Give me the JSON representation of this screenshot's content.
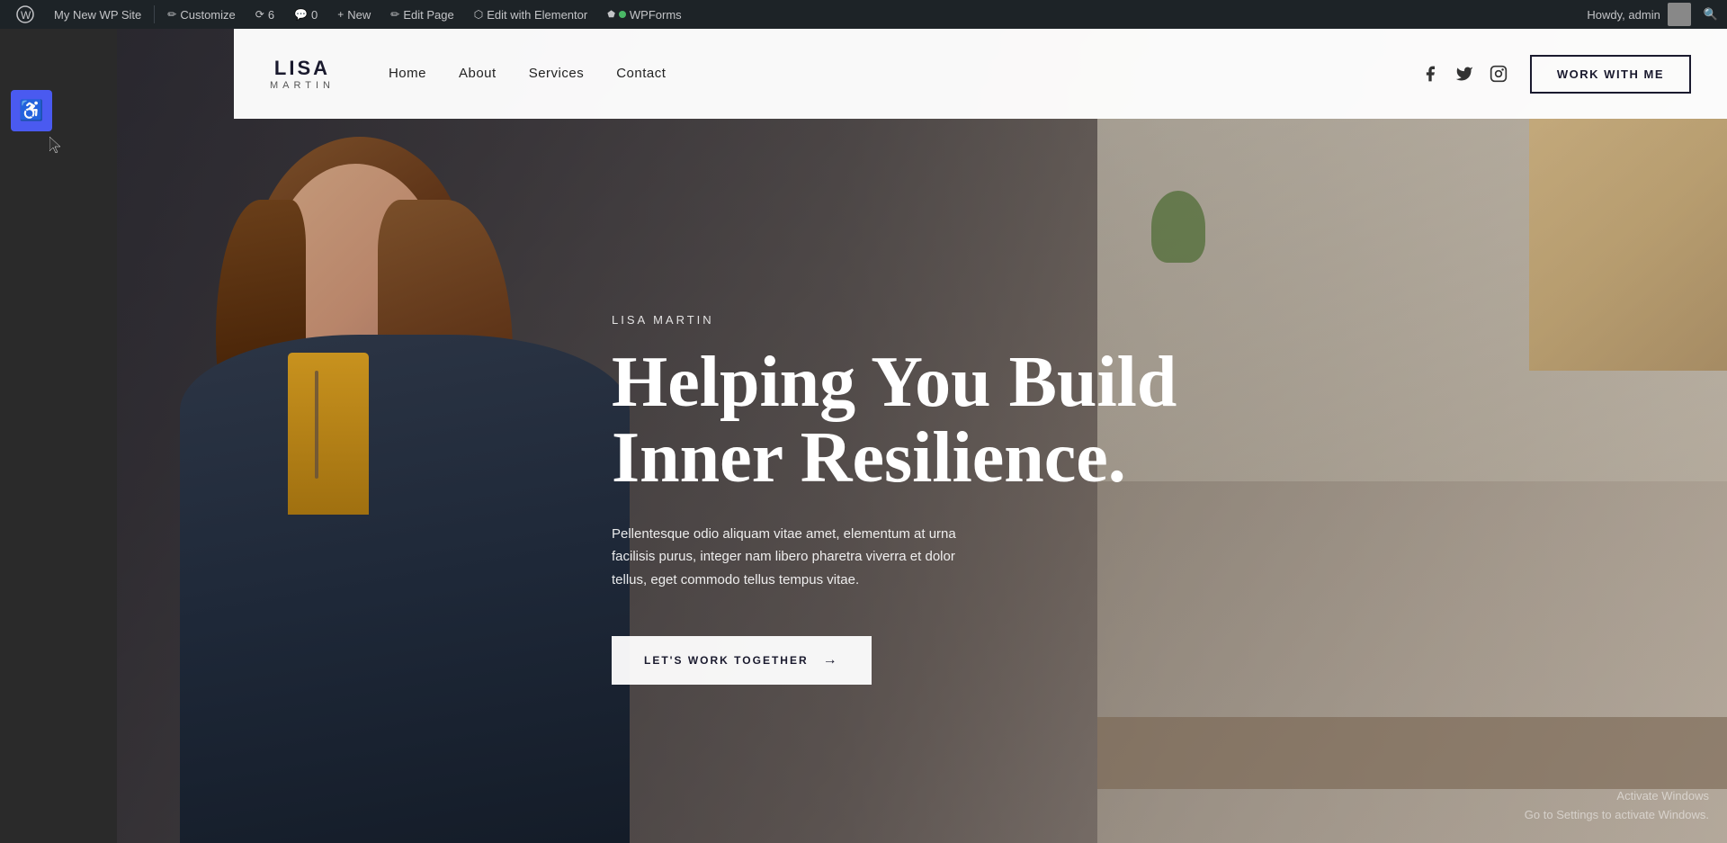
{
  "adminBar": {
    "siteTitle": "My New WP Site",
    "customize": "Customize",
    "comments": "0",
    "revisions": "6",
    "new": "New",
    "editPage": "Edit Page",
    "editWithElementor": "Edit with Elementor",
    "wpForms": "WPForms",
    "howdy": "Howdy, admin"
  },
  "nav": {
    "logoName": "LISA",
    "logoSub": "MARTIN",
    "links": [
      {
        "label": "Home",
        "href": "#"
      },
      {
        "label": "About",
        "href": "#"
      },
      {
        "label": "Services",
        "href": "#"
      },
      {
        "label": "Contact",
        "href": "#"
      }
    ],
    "workWithMe": "WORK WITH ME"
  },
  "hero": {
    "eyebrow": "LISA MARTIN",
    "headline": "Helping You Build\nInner Resilience.",
    "headlineLine1": "Helping You Build",
    "headlineLine2": "Inner Resilience.",
    "subtext": "Pellentesque odio aliquam vitae amet, elementum at urna facilisis purus, integer nam libero pharetra viverra et dolor tellus, eget commodo tellus tempus vitae.",
    "ctaLabel": "LET'S WORK TOGETHER",
    "ctaArrow": "→"
  },
  "accessibility": {
    "icon": "♿"
  },
  "windowsWatermark": {
    "line1": "Activate Windows",
    "line2": "Go to Settings to activate Windows."
  },
  "social": {
    "facebook": "f",
    "twitter": "t",
    "instagram": "i"
  }
}
